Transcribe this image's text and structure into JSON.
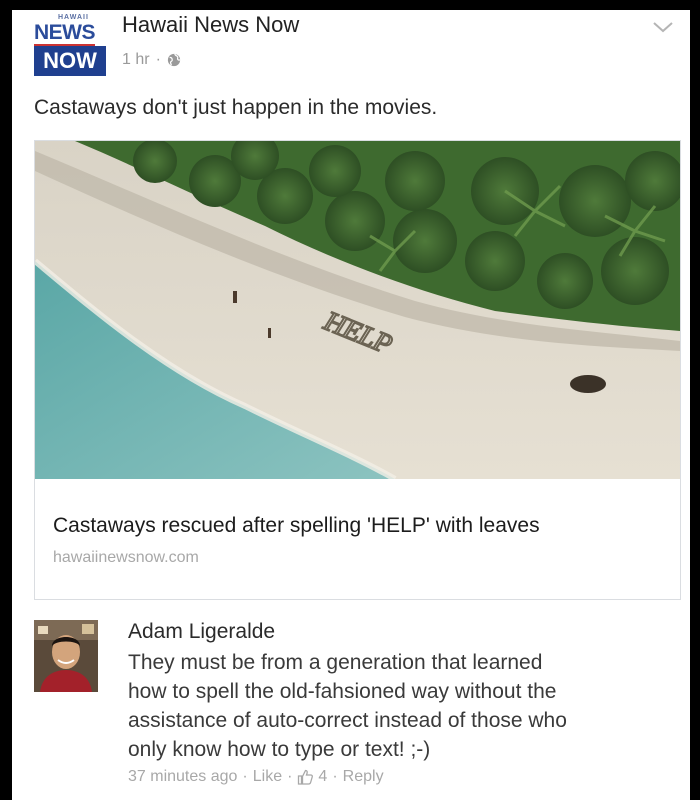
{
  "post": {
    "logo": {
      "small": "HAWAII",
      "line1": "NEWS",
      "line2": "NOW"
    },
    "page_name": "Hawaii News Now",
    "time": "1 hr",
    "separator": "·",
    "text": "Castaways don't just happen in the movies.",
    "link_card": {
      "title": "Castaways rescued after spelling 'HELP' with leaves",
      "domain": "hawaiinewsnow.com",
      "image_text": "HELP"
    }
  },
  "comment": {
    "author": "Adam Ligeralde",
    "lines": [
      "They must be from a generation that learned",
      "how to spell the old-fahsioned way without the",
      "assistance of auto-correct instead of those who",
      "only know how to type or text!  ;-)"
    ],
    "time": "37 minutes ago",
    "like_label": "Like",
    "like_count": "4",
    "reply_label": "Reply",
    "separator": "·"
  },
  "icons": [
    "globe-icon",
    "chevron-down-icon",
    "thumbs-up-icon"
  ],
  "colors": {
    "logo_blue": "#1f3f8f",
    "text": "#2b2b2b",
    "muted": "#a8a8a8"
  }
}
